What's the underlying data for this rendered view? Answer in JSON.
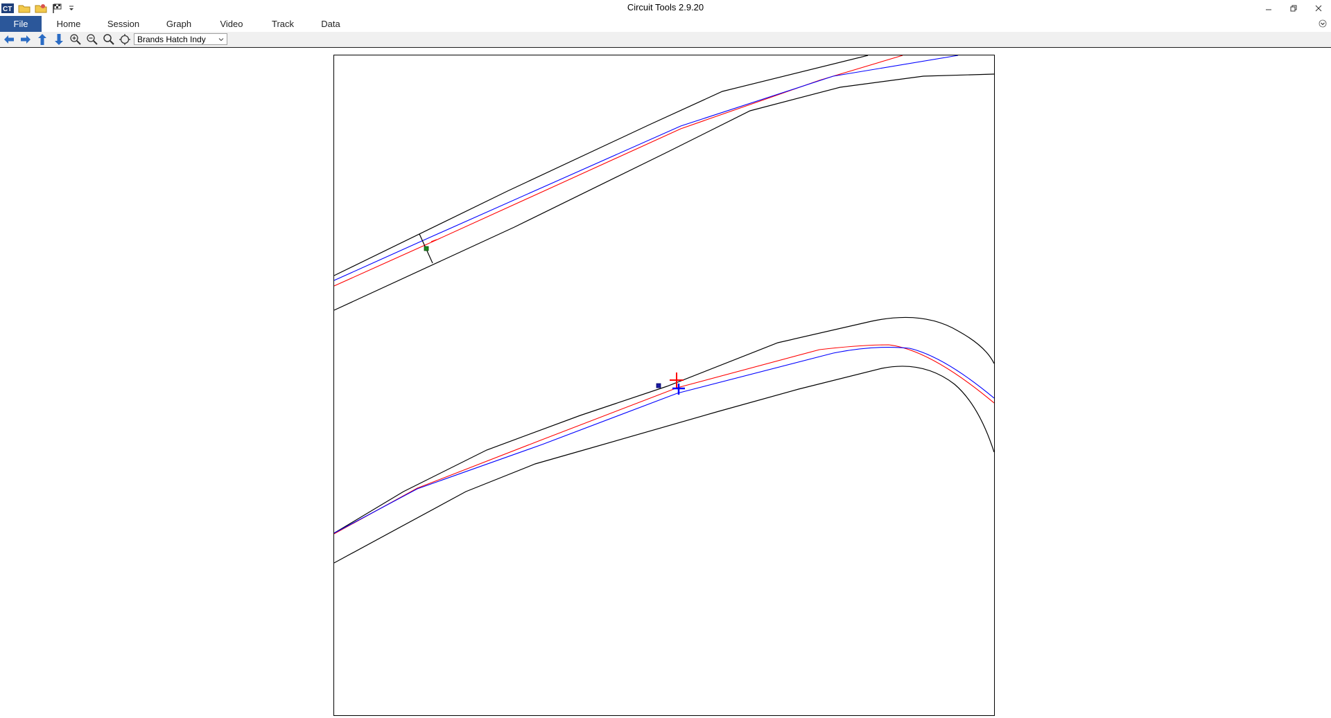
{
  "window": {
    "title": "Circuit Tools 2.9.20",
    "controls": [
      "minimize-icon",
      "restore-icon",
      "close-icon"
    ]
  },
  "quick_access": [
    "app-logo-icon",
    "open-folder-icon",
    "open-session-icon",
    "flag-icon",
    "customize-dropdown-icon"
  ],
  "ribbon": {
    "tabs": [
      {
        "label": "File",
        "active": true
      },
      {
        "label": "Home"
      },
      {
        "label": "Session"
      },
      {
        "label": "Graph"
      },
      {
        "label": "Video"
      },
      {
        "label": "Track"
      },
      {
        "label": "Data"
      }
    ],
    "collapse_icon": "chevron-down-icon"
  },
  "toolbar": {
    "buttons": [
      "arrow-left-icon",
      "arrow-right-icon",
      "arrow-up-icon",
      "arrow-down-icon",
      "zoom-in-icon",
      "zoom-out-icon",
      "zoom-fit-icon",
      "center-icon"
    ],
    "track_select": {
      "value": "Brands Hatch Indy",
      "icon": "chevron-down-icon"
    },
    "icon_color": "#2b6cc4"
  },
  "map": {
    "track_edge_color": "#000000",
    "lap_line_colors": {
      "red": "#ff0000",
      "blue": "#0000ff"
    },
    "marker_colors": {
      "start_finish": "#1a8a1a",
      "blue_marker": "#1a1aa0"
    }
  }
}
